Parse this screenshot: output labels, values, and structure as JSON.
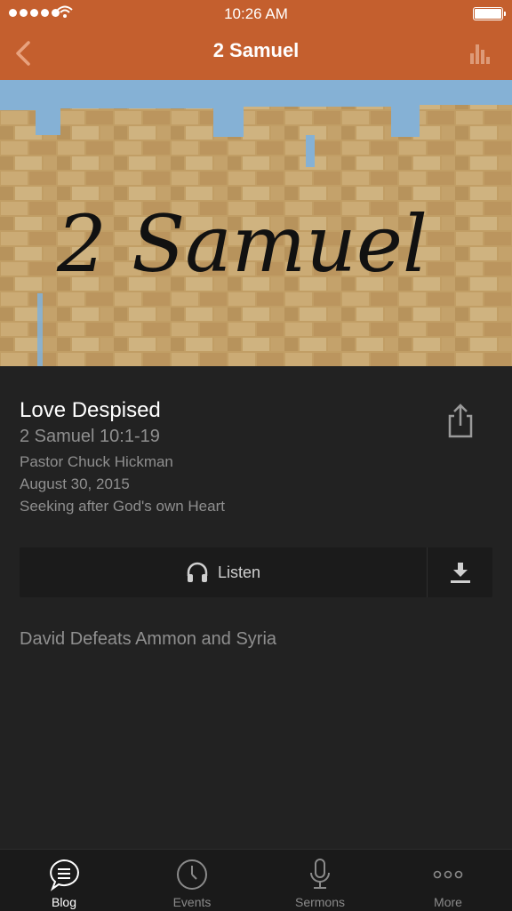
{
  "status_bar": {
    "time": "10:26 AM"
  },
  "nav": {
    "title": "2 Samuel"
  },
  "hero": {
    "art_text": "2 Samuel"
  },
  "sermon": {
    "title": "Love Despised",
    "reference": "2 Samuel 10:1-19",
    "speaker": "Pastor Chuck Hickman",
    "date": "August 30, 2015",
    "series": "Seeking after God's own Heart",
    "description": "David Defeats Ammon and Syria"
  },
  "actions": {
    "listen_label": "Listen"
  },
  "tabs": [
    {
      "label": "Blog",
      "icon": "chat-bubble-icon",
      "active": true
    },
    {
      "label": "Events",
      "icon": "clock-icon",
      "active": false
    },
    {
      "label": "Sermons",
      "icon": "microphone-icon",
      "active": false
    },
    {
      "label": "More",
      "icon": "more-dots-icon",
      "active": false
    }
  ],
  "colors": {
    "nav_bar": "#c45f2e",
    "background": "#222222",
    "secondary_text": "#8f8f8f"
  }
}
